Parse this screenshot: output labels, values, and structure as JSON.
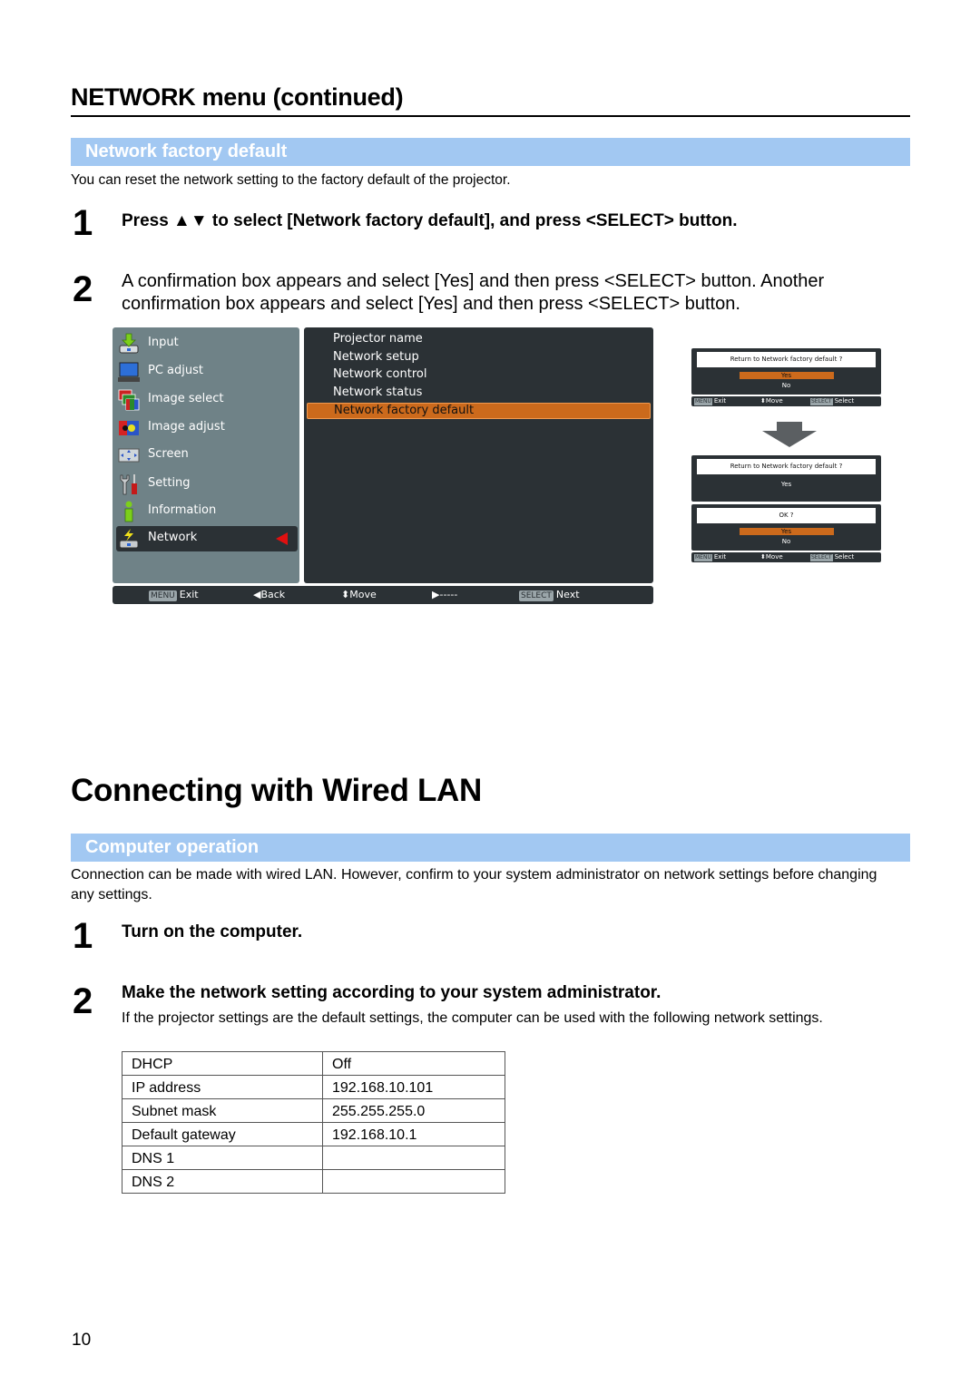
{
  "section_heading": "NETWORK menu (continued)",
  "factory_default": {
    "band_title": "Network factory default",
    "intro": "You can reset the network setting to the factory default of the projector.",
    "steps": [
      {
        "number": "1",
        "text": "Press ▲▼ to select [Network factory default], and press <SELECT> button."
      },
      {
        "number": "2",
        "text": "A confirmation box appears and select [Yes] and then press <SELECT> button.  Another confirmation box appears and select [Yes] and then press <SELECT> button."
      }
    ]
  },
  "osd_menu": {
    "main_items": [
      {
        "label": "Input",
        "icon": "input-icon"
      },
      {
        "label": "PC adjust",
        "icon": "pc-adjust-icon"
      },
      {
        "label": "Image select",
        "icon": "image-select-icon"
      },
      {
        "label": "Image adjust",
        "icon": "image-adjust-icon"
      },
      {
        "label": "Screen",
        "icon": "screen-icon"
      },
      {
        "label": "Setting",
        "icon": "setting-icon"
      },
      {
        "label": "Information",
        "icon": "information-icon"
      },
      {
        "label": "Network",
        "icon": "network-icon",
        "selected": true
      }
    ],
    "sub_items": [
      {
        "label": "Projector name"
      },
      {
        "label": "Network setup"
      },
      {
        "label": "Network control"
      },
      {
        "label": "Network status"
      },
      {
        "label": "Network factory default",
        "selected": true
      }
    ],
    "footer": {
      "exit_key": "MENU",
      "exit_label": "Exit",
      "back_label": "Back",
      "move_label": "Move",
      "next_placeholder": "-----",
      "select_key": "SELECT",
      "select_label": "Next"
    },
    "colors": {
      "highlight": "#cc6a1c",
      "panel_dark": "#2b3135",
      "panel_light": "#6f8287"
    }
  },
  "dialogs": {
    "first": {
      "question": "Return to Network factory default ?",
      "options": [
        "Yes",
        "No"
      ],
      "selected": "Yes"
    },
    "second_top": {
      "question": "Return to Network factory default ?",
      "answer": "Yes"
    },
    "second_bottom": {
      "question": "OK ?",
      "options": [
        "Yes",
        "No"
      ],
      "selected": "Yes"
    },
    "footer": {
      "exit_key": "MENU",
      "exit_label": "Exit",
      "move_label": "Move",
      "select_key": "SELECT",
      "select_label": "Select"
    }
  },
  "wired_lan": {
    "heading": "Connecting with Wired LAN",
    "band_title": "Computer operation",
    "intro": "Connection can be made with wired LAN. However, confirm to your system administrator on network settings before changing any settings.",
    "steps": [
      {
        "number": "1",
        "text": "Turn on the computer."
      },
      {
        "number": "2",
        "text": "Make the network setting according to your system administrator.",
        "detail": "If the projector settings are the default settings, the computer can be used with the following network settings."
      }
    ],
    "table": [
      {
        "setting": "DHCP",
        "value": "Off"
      },
      {
        "setting": "IP address",
        "value": "192.168.10.101"
      },
      {
        "setting": "Subnet mask",
        "value": "255.255.255.0"
      },
      {
        "setting": "Default gateway",
        "value": "192.168.10.1"
      },
      {
        "setting": "DNS 1",
        "value": ""
      },
      {
        "setting": "DNS 2",
        "value": ""
      }
    ]
  },
  "page_number": "10"
}
